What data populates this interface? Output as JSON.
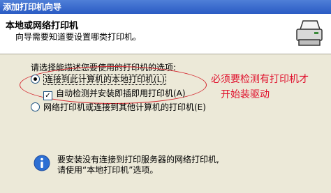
{
  "window": {
    "title": "添加打印机向导"
  },
  "header": {
    "title": "本地或网络打印机",
    "subtitle": "向导需要知道要设置哪类打印机。"
  },
  "icons": {
    "header": "printer-icon",
    "info": "info-icon"
  },
  "form": {
    "prompt": "请选择能描述您要使用的打印机的选项:",
    "option_local": "连接到此计算机的本地打印机(L)",
    "auto_detect": "自动检测并安装即插即用打印机(A)",
    "option_network": "网络打印机或连接到其他计算机的打印机(E)"
  },
  "annotation": {
    "line1": "必须要检测有打印机才",
    "line2": "开始装驱动"
  },
  "info": {
    "line1": "要安装没有连接到打印服务器的网络打印机,",
    "line2": "请使用“本地打印机”选项。"
  },
  "colors": {
    "annotation": "#e0102c",
    "title_bar": "#2a5bc4"
  }
}
